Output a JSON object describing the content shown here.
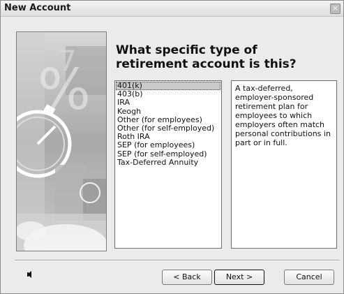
{
  "window": {
    "title": "New Account",
    "close_glyph": "×"
  },
  "heading": "What specific type of retirement account is this?",
  "account_types": [
    "401(k)",
    "403(b)",
    "IRA",
    "Keogh",
    "Other (for employees)",
    "Other (for self-employed)",
    "Roth IRA",
    "SEP (for employees)",
    "SEP (for self-employed)",
    "Tax-Deferred Annuity"
  ],
  "selected_index": 0,
  "description": "A tax-deferred, employer-sponsored retirement plan for employees to which employers often match personal contributions in part or in full.",
  "buttons": {
    "back": "< Back",
    "next": "Next >",
    "cancel": "Cancel"
  },
  "icons": {
    "help": "speaker-left-icon",
    "art": "stopwatch-graphic"
  }
}
